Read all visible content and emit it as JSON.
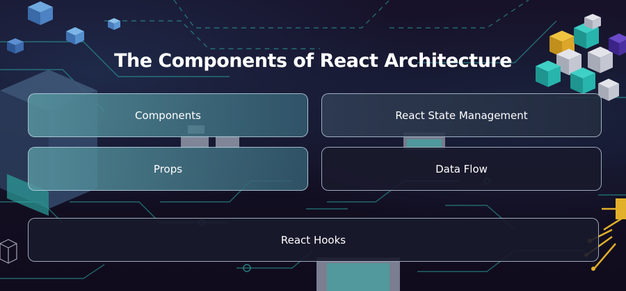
{
  "title": "The Components of React Architecture",
  "cards": [
    {
      "label": "Components"
    },
    {
      "label": "React State Management"
    },
    {
      "label": "Props"
    },
    {
      "label": "Data Flow"
    },
    {
      "label": "React Hooks"
    }
  ],
  "colors": {
    "background": "#130f22",
    "circuit_line": "#2fb0a8",
    "teal_cube": "#27b5ae",
    "grey_cube": "#c9ccd6",
    "gold_cube": "#e3b02c",
    "purple_cube": "#4a2fa0"
  }
}
